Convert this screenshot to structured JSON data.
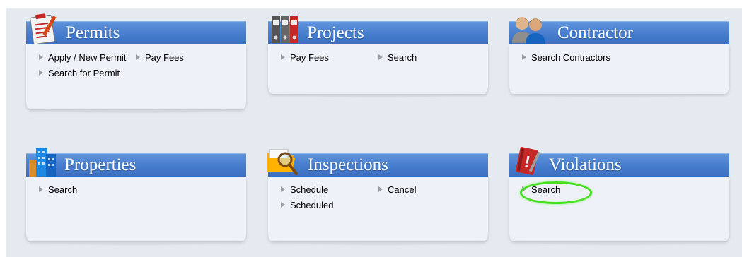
{
  "cards": {
    "permits": {
      "title": "Permits",
      "icon": "clipboard-pencil-icon",
      "links": [
        "Apply / New Permit",
        "Pay Fees",
        "Search for Permit"
      ]
    },
    "projects": {
      "title": "Projects",
      "icon": "binders-icon",
      "links": [
        "Pay Fees",
        "Search"
      ]
    },
    "contractor": {
      "title": "Contractor",
      "icon": "people-icon",
      "links": [
        "Search Contractors"
      ]
    },
    "properties": {
      "title": "Properties",
      "icon": "buildings-icon",
      "links": [
        "Search"
      ]
    },
    "inspections": {
      "title": "Inspections",
      "icon": "folder-magnifier-icon",
      "links": [
        "Schedule",
        "Cancel",
        "Scheduled"
      ]
    },
    "violations": {
      "title": "Violations",
      "icon": "notebook-alert-icon",
      "links": [
        "Search"
      ]
    }
  },
  "colors": {
    "header": "#4a80cf",
    "body": "#eef1f8",
    "background": "#e5e9f0",
    "highlight": "#46e020"
  }
}
